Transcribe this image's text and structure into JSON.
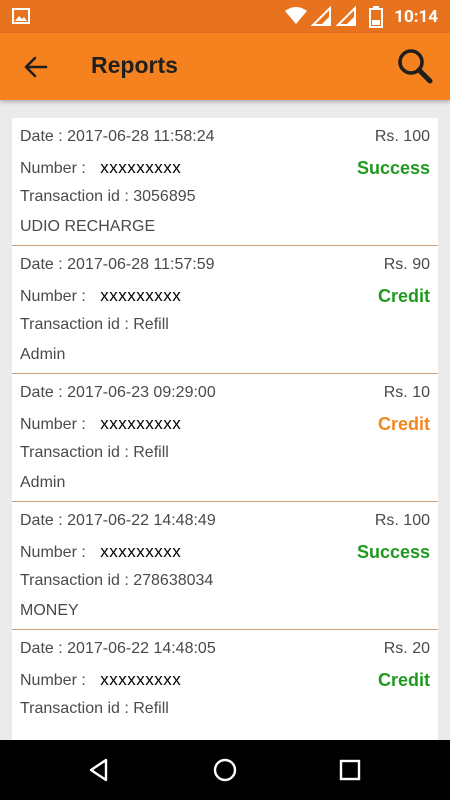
{
  "status_bar": {
    "time": "10:14"
  },
  "app_bar": {
    "title": "Reports"
  },
  "colors": {
    "success": "#1f9a1f",
    "credit_green": "#1f9a1f",
    "credit_orange": "#f5861f"
  },
  "labels": {
    "date": "Date : ",
    "number": "Number : ",
    "txn": "Transaction id : "
  },
  "reports": [
    {
      "date": "2017-06-28 11:58:24",
      "amount": "Rs. 100",
      "number": "xxxxxxxxx",
      "status": "Success",
      "status_color": "#1f9a1f",
      "txn": "3056895",
      "desc": "UDIO RECHARGE"
    },
    {
      "date": "2017-06-28 11:57:59",
      "amount": "Rs. 90",
      "number": "xxxxxxxxx",
      "status": "Credit",
      "status_color": "#1f9a1f",
      "txn": "Refill",
      "desc": "Admin"
    },
    {
      "date": "2017-06-23 09:29:00",
      "amount": "Rs. 10",
      "number": "xxxxxxxxx",
      "status": "Credit",
      "status_color": "#f5861f",
      "txn": "Refill",
      "desc": "Admin"
    },
    {
      "date": "2017-06-22 14:48:49",
      "amount": "Rs. 100",
      "number": "xxxxxxxxx",
      "status": "Success",
      "status_color": "#1f9a1f",
      "txn": "278638034",
      "desc": "MONEY"
    },
    {
      "date": "2017-06-22 14:48:05",
      "amount": "Rs. 20",
      "number": "xxxxxxxxx",
      "status": "Credit",
      "status_color": "#1f9a1f",
      "txn": "Refill",
      "desc": ""
    }
  ]
}
